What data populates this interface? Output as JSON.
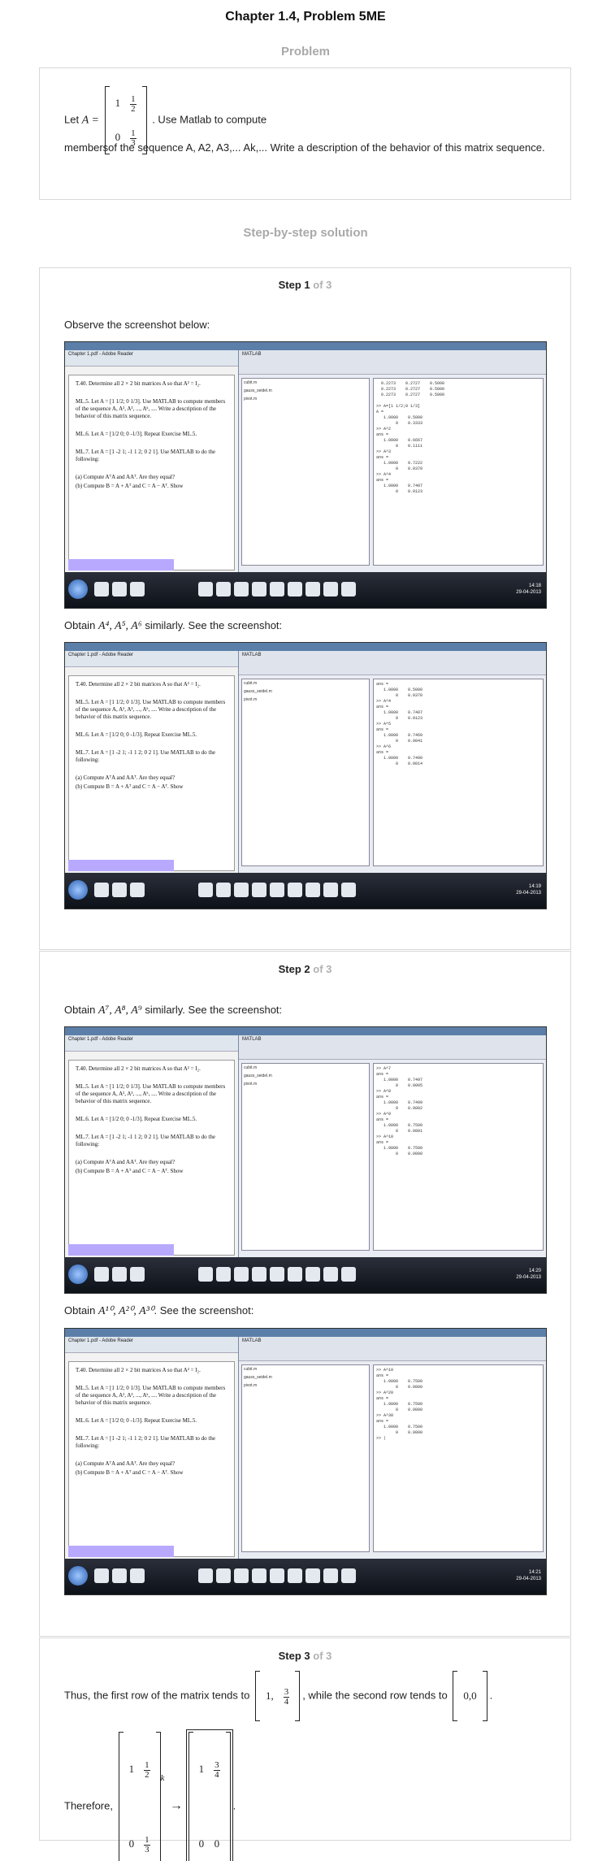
{
  "title": "Chapter 1.4, Problem 5ME",
  "problem_heading": "Problem",
  "problem": {
    "let": "Let",
    "var": "A =",
    "matrix": [
      [
        "1",
        "1/2"
      ],
      [
        "0",
        "1/3"
      ]
    ],
    "after_matrix": ". Use Matlab to compute",
    "text2": "membersof the sequence A, A2, A3,... Ak,... Write a description of the behavior of this matrix sequence."
  },
  "solution_heading": "Step-by-step solution",
  "steps": [
    {
      "label": "Step 1",
      "of": "of 3",
      "line1": "Observe the screenshot below:",
      "line2_pre": "Obtain",
      "line2_math": "A⁴, A⁵, A⁶",
      "line2_post": "similarly. See the screenshot:"
    },
    {
      "label": "Step 2",
      "of": "of 3",
      "line1_pre": "Obtain",
      "line1_math": "A⁷, A⁸, A⁹",
      "line1_post": "similarly. See the screenshot:",
      "line2_pre": "Obtain",
      "line2_math": "A¹⁰, A²⁰, A³⁰",
      "line2_post": ". See the screenshot:"
    },
    {
      "label": "Step 3",
      "of": "of 3",
      "conclusion_pre": "Thus, the first row of the matrix tends to",
      "first_row_limit": "[1, 3/4]",
      "conclusion_mid": ", while the second row tends to",
      "second_row_limit": "[0,0]",
      "therefore": "Therefore,",
      "limit_matrix": [
        [
          "1",
          "3/4"
        ],
        [
          "0",
          "0"
        ]
      ]
    }
  ],
  "screenshot": {
    "reader_title": "Chapter 1.pdf - Adobe Reader",
    "matlab_title": "MATLAB",
    "t40": "T.40. Determine all 2 × 2 bit matrices A so that A² = I₂.",
    "ml5": "ML.5. Let A = [1 1/2; 0 1/3]. Use MATLAB to compute members of the sequence A, A², A³, ..., Aᵏ, .... Write a description of the behavior of this matrix sequence.",
    "ml6": "ML.6. Let A = [1/2 0; 0 -1/3]. Repeat Exercise ML.5.",
    "ml7": "ML.7. Let A = [1 -2 1; -1 1 2; 0 2 1]. Use MATLAB to do the following:",
    "ml7a": "(a) Compute AᵀA and AAᵀ. Are they equal?",
    "ml7b": "(b) Compute B = A + Aᵀ and C = A − Aᵀ. Show",
    "files": [
      "cubit.m",
      "gauss_seidel.m",
      "pivot.m"
    ],
    "cmd1": "  0.2273    0.2727    0.5000\n  0.2273    0.2727    0.5000\n  0.2273    0.2727    0.5000\n\n>> A=[1 1/2;0 1/3]\nA =\n   1.0000    0.5000\n        0    0.3333\n>> A^2\nans =\n   1.0000    0.6667\n        0    0.1111\n>> A^3\nans =\n   1.0000    0.7222\n        0    0.0370\n>> A^4\nans =\n   1.0000    0.7407\n        0    0.0123",
    "cmd2": "ans =\n   1.0000    0.5000\n        0    0.0370\n>> A^4\nans =\n   1.0000    0.7407\n        0    0.0123\n>> A^5\nans =\n   1.0000    0.7469\n        0    0.0041\n>> A^6\nans =\n   1.0000    0.7490\n        0    0.0014",
    "cmd3": ">> A^7\nans =\n   1.0000    0.7497\n        0    0.0005\n>> A^8\nans =\n   1.0000    0.7499\n        0    0.0002\n>> A^9\nans =\n   1.0000    0.7500\n        0    0.0001\n>> A^10\nans =\n   1.0000    0.7500\n        0    0.0000",
    "cmd4": ">> A^10\nans =\n   1.0000    0.7500\n        0    0.0000\n>> A^20\nans =\n   1.0000    0.7500\n        0    0.0000\n>> A^30\nans =\n   1.0000    0.7500\n        0    0.0000\n>> |",
    "clocks": [
      "14:18\n29-04-2013",
      "14:19\n29-04-2013",
      "14:20\n29-04-2013",
      "14:21\n29-04-2013"
    ]
  }
}
